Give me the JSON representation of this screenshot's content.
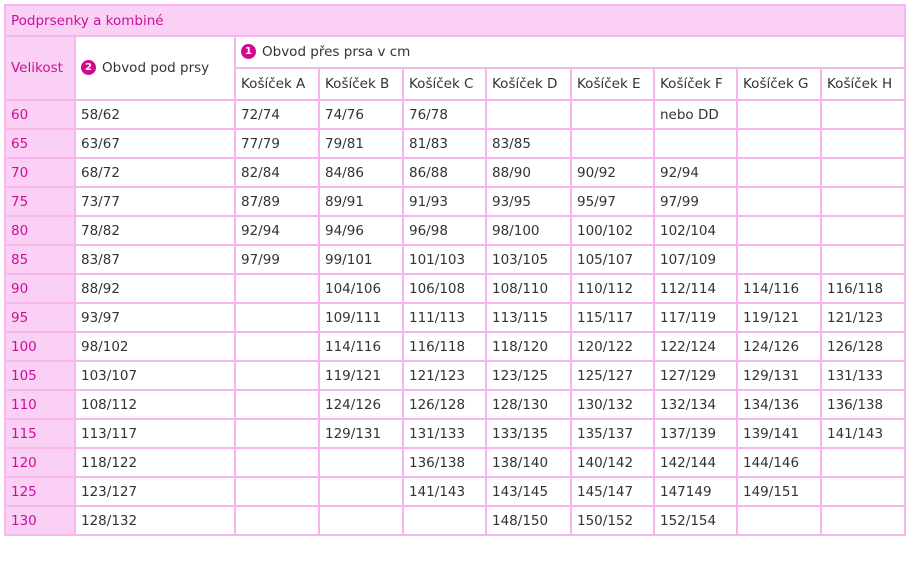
{
  "title": "Podprsenky a kombiné",
  "header": {
    "size_label": "Velikost",
    "under_label": "Obvod pod prsy",
    "under_badge": "2",
    "bust_label": "Obvod přes prsa v cm",
    "bust_badge": "1",
    "cups": [
      "Košíček A",
      "Košíček B",
      "Košíček C",
      "Košíček D",
      "Košíček E",
      "Košíček F",
      "Košíček G",
      "Košíček H"
    ]
  },
  "colors": {
    "accent": "#cc0f9a",
    "header_bg": "#fbd0f5",
    "border": "#f6b7ec",
    "badge": "#d4088f"
  },
  "rows": [
    {
      "size": "60",
      "under": "58/62",
      "cups": [
        "72/74",
        "74/76",
        "76/78",
        "",
        "",
        "nebo DD",
        "",
        ""
      ]
    },
    {
      "size": "65",
      "under": "63/67",
      "cups": [
        "77/79",
        "79/81",
        "81/83",
        "83/85",
        "",
        "",
        "",
        ""
      ]
    },
    {
      "size": "70",
      "under": "68/72",
      "cups": [
        "82/84",
        "84/86",
        "86/88",
        "88/90",
        "90/92",
        "92/94",
        "",
        ""
      ]
    },
    {
      "size": "75",
      "under": "73/77",
      "cups": [
        "87/89",
        "89/91",
        "91/93",
        "93/95",
        "95/97",
        "97/99",
        "",
        ""
      ]
    },
    {
      "size": "80",
      "under": "78/82",
      "cups": [
        "92/94",
        "94/96",
        "96/98",
        "98/100",
        "100/102",
        "102/104",
        "",
        ""
      ]
    },
    {
      "size": "85",
      "under": "83/87",
      "cups": [
        "97/99",
        "99/101",
        "101/103",
        "103/105",
        "105/107",
        "107/109",
        "",
        ""
      ]
    },
    {
      "size": "90",
      "under": "88/92",
      "cups": [
        "",
        "104/106",
        "106/108",
        "108/110",
        "110/112",
        "112/114",
        "114/116",
        "116/118"
      ]
    },
    {
      "size": "95",
      "under": "93/97",
      "cups": [
        "",
        "109/111",
        "111/113",
        "113/115",
        "115/117",
        "117/119",
        "119/121",
        "121/123"
      ]
    },
    {
      "size": "100",
      "under": "98/102",
      "cups": [
        "",
        "114/116",
        "116/118",
        "118/120",
        "120/122",
        "122/124",
        "124/126",
        "126/128"
      ]
    },
    {
      "size": "105",
      "under": "103/107",
      "cups": [
        "",
        "119/121",
        "121/123",
        "123/125",
        "125/127",
        "127/129",
        "129/131",
        "131/133"
      ]
    },
    {
      "size": "110",
      "under": "108/112",
      "cups": [
        "",
        "124/126",
        "126/128",
        "128/130",
        "130/132",
        "132/134",
        "134/136",
        "136/138"
      ]
    },
    {
      "size": "115",
      "under": "113/117",
      "cups": [
        "",
        "129/131",
        "131/133",
        "133/135",
        "135/137",
        "137/139",
        "139/141",
        "141/143"
      ]
    },
    {
      "size": "120",
      "under": "118/122",
      "cups": [
        "",
        "",
        "136/138",
        "138/140",
        "140/142",
        "142/144",
        "144/146",
        ""
      ]
    },
    {
      "size": "125",
      "under": "123/127",
      "cups": [
        "",
        "",
        "141/143",
        "143/145",
        "145/147",
        "147149",
        "149/151",
        ""
      ]
    },
    {
      "size": "130",
      "under": "128/132",
      "cups": [
        "",
        "",
        "",
        "148/150",
        "150/152",
        "152/154",
        "",
        ""
      ]
    }
  ]
}
